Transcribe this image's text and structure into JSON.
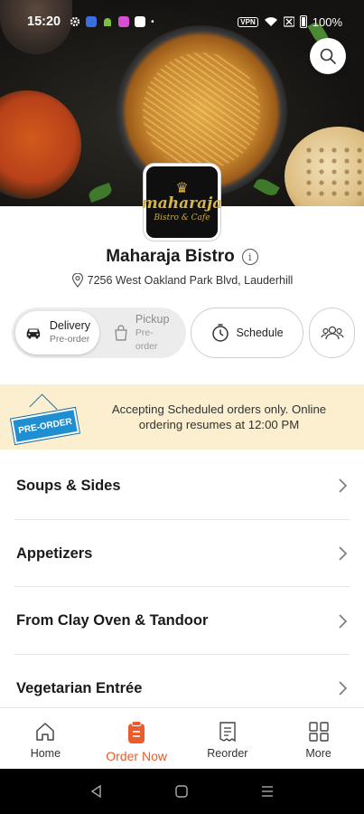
{
  "status_bar": {
    "time": "15:20",
    "vpn": "VPN",
    "battery": "100%"
  },
  "restaurant": {
    "logo_title": "maharaja",
    "logo_subtitle": "Bistro & Cafe",
    "name": "Maharaja Bistro",
    "address": "7256 West Oakland Park Blvd, Lauderhill"
  },
  "order_mode": {
    "delivery_label": "Delivery",
    "delivery_sub": "Pre-order",
    "pickup_label": "Pickup",
    "pickup_sub": "Pre-order",
    "schedule_label": "Schedule",
    "selected": "Delivery"
  },
  "banner": {
    "tag": "PRE-ORDER",
    "message": "Accepting Scheduled orders only. Online ordering resumes at 12:00 PM"
  },
  "menu_categories": [
    {
      "label": "Soups & Sides"
    },
    {
      "label": "Appetizers"
    },
    {
      "label": "From Clay Oven & Tandoor"
    },
    {
      "label": "Vegetarian Entrée"
    }
  ],
  "bottom_nav": [
    {
      "label": "Home",
      "icon": "home-icon"
    },
    {
      "label": "Order Now",
      "icon": "order-icon"
    },
    {
      "label": "Reorder",
      "icon": "receipt-icon"
    },
    {
      "label": "More",
      "icon": "grid-icon"
    }
  ],
  "colors": {
    "accent": "#ec5b2c",
    "banner_bg": "#fbefcf",
    "preorder_blue": "#1f8fd1",
    "logo_gold": "#d6b44a"
  }
}
